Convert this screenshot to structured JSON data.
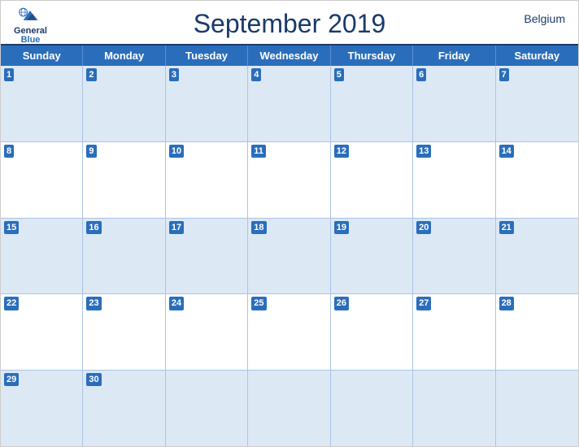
{
  "header": {
    "title": "September 2019",
    "country": "Belgium",
    "logo": {
      "general": "General",
      "blue": "Blue"
    }
  },
  "days_of_week": [
    "Sunday",
    "Monday",
    "Tuesday",
    "Wednesday",
    "Thursday",
    "Friday",
    "Saturday"
  ],
  "weeks": [
    [
      {
        "day": 1,
        "empty": false
      },
      {
        "day": 2,
        "empty": false
      },
      {
        "day": 3,
        "empty": false
      },
      {
        "day": 4,
        "empty": false
      },
      {
        "day": 5,
        "empty": false
      },
      {
        "day": 6,
        "empty": false
      },
      {
        "day": 7,
        "empty": false
      }
    ],
    [
      {
        "day": 8,
        "empty": false
      },
      {
        "day": 9,
        "empty": false
      },
      {
        "day": 10,
        "empty": false
      },
      {
        "day": 11,
        "empty": false
      },
      {
        "day": 12,
        "empty": false
      },
      {
        "day": 13,
        "empty": false
      },
      {
        "day": 14,
        "empty": false
      }
    ],
    [
      {
        "day": 15,
        "empty": false
      },
      {
        "day": 16,
        "empty": false
      },
      {
        "day": 17,
        "empty": false
      },
      {
        "day": 18,
        "empty": false
      },
      {
        "day": 19,
        "empty": false
      },
      {
        "day": 20,
        "empty": false
      },
      {
        "day": 21,
        "empty": false
      }
    ],
    [
      {
        "day": 22,
        "empty": false
      },
      {
        "day": 23,
        "empty": false
      },
      {
        "day": 24,
        "empty": false
      },
      {
        "day": 25,
        "empty": false
      },
      {
        "day": 26,
        "empty": false
      },
      {
        "day": 27,
        "empty": false
      },
      {
        "day": 28,
        "empty": false
      }
    ],
    [
      {
        "day": 29,
        "empty": false
      },
      {
        "day": 30,
        "empty": false
      },
      {
        "day": null,
        "empty": true
      },
      {
        "day": null,
        "empty": true
      },
      {
        "day": null,
        "empty": true
      },
      {
        "day": null,
        "empty": true
      },
      {
        "day": null,
        "empty": true
      }
    ]
  ],
  "colors": {
    "header_blue": "#2a6ebb",
    "dark_blue": "#1a3a6b",
    "row_blue_bg": "#dde8f5",
    "border": "#aac4e8"
  }
}
